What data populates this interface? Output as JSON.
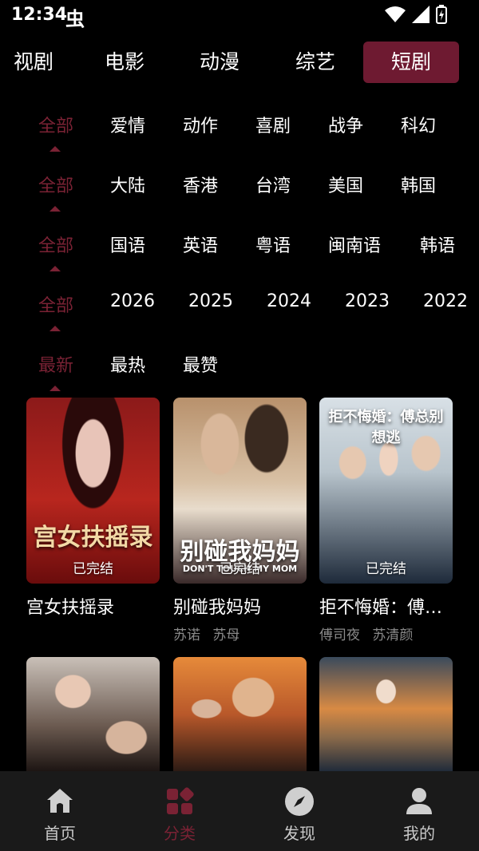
{
  "status": {
    "time": "12:34",
    "extra": "虫"
  },
  "top_tabs": [
    "视剧",
    "电影",
    "动漫",
    "综艺",
    "短剧"
  ],
  "filters": {
    "genre": [
      "全部",
      "爱情",
      "动作",
      "喜剧",
      "战争",
      "科幻"
    ],
    "region": [
      "全部",
      "大陆",
      "香港",
      "台湾",
      "美国",
      "韩国"
    ],
    "language": [
      "全部",
      "国语",
      "英语",
      "粤语",
      "闽南语",
      "韩语"
    ],
    "year": [
      "全部",
      "2026",
      "2025",
      "2024",
      "2023",
      "2022"
    ],
    "sort": [
      "最新",
      "最热",
      "最赞"
    ]
  },
  "cards": [
    {
      "title": "宫女扶摇录",
      "badge": "已完结",
      "poster_text": "宫女扶摇录",
      "actors": []
    },
    {
      "title": "别碰我妈妈",
      "badge": "已完结",
      "poster_text": "别碰我妈妈",
      "poster_sub": "DON'T TOUCH MY MOM",
      "actors": [
        "苏诺",
        "苏母"
      ]
    },
    {
      "title": "拒不悔婚：傅…",
      "badge": "已完结",
      "poster_text": "拒不悔婚：傅总别想逃",
      "actors": [
        "傅司夜",
        "苏清颜"
      ]
    }
  ],
  "nav": [
    {
      "label": "首页",
      "icon": "home-icon"
    },
    {
      "label": "分类",
      "icon": "category-icon"
    },
    {
      "label": "发现",
      "icon": "compass-icon"
    },
    {
      "label": "我的",
      "icon": "profile-icon"
    }
  ],
  "colors": {
    "accent": "#7a2234",
    "tab_active_bg": "#6e1a31",
    "background": "#000000",
    "nav_bg": "#1a1a1a"
  }
}
